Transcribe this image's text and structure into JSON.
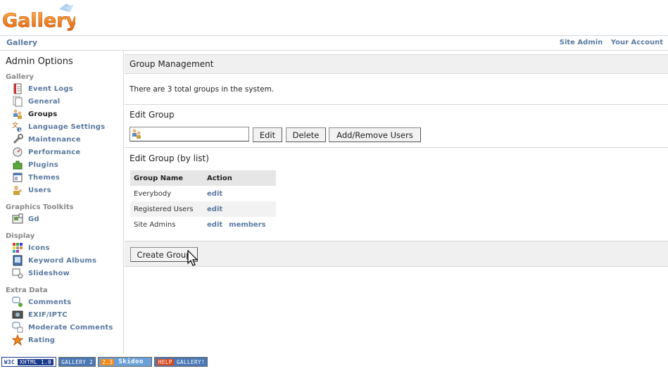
{
  "header": {
    "logo_text": "Gallery",
    "breadcrumb": "Gallery",
    "links": [
      "Site Admin",
      "Your Account"
    ]
  },
  "sidebar": {
    "title": "Admin Options",
    "groups": [
      {
        "label": "Gallery",
        "items": [
          {
            "label": "Event Logs",
            "icon": "event-logs-icon"
          },
          {
            "label": "General",
            "icon": "general-icon"
          },
          {
            "label": "Groups",
            "icon": "groups-icon",
            "active": true
          },
          {
            "label": "Language Settings",
            "icon": "language-icon"
          },
          {
            "label": "Maintenance",
            "icon": "maintenance-icon"
          },
          {
            "label": "Performance",
            "icon": "performance-icon"
          },
          {
            "label": "Plugins",
            "icon": "plugins-icon"
          },
          {
            "label": "Themes",
            "icon": "themes-icon"
          },
          {
            "label": "Users",
            "icon": "users-icon"
          }
        ]
      },
      {
        "label": "Graphics Toolkits",
        "items": [
          {
            "label": "Gd",
            "icon": "gd-icon"
          }
        ]
      },
      {
        "label": "Display",
        "items": [
          {
            "label": "Icons",
            "icon": "icons-icon"
          },
          {
            "label": "Keyword Albums",
            "icon": "keyword-albums-icon"
          },
          {
            "label": "Slideshow",
            "icon": "slideshow-icon"
          }
        ]
      },
      {
        "label": "Extra Data",
        "items": [
          {
            "label": "Comments",
            "icon": "comments-icon"
          },
          {
            "label": "EXIF/IPTC",
            "icon": "exif-icon"
          },
          {
            "label": "Moderate Comments",
            "icon": "moderate-comments-icon"
          },
          {
            "label": "Rating",
            "icon": "rating-icon"
          }
        ]
      }
    ]
  },
  "main": {
    "heading": "Group Management",
    "info": "There are 3 total groups in the system.",
    "edit_group": {
      "title": "Edit Group",
      "input_value": "",
      "buttons": [
        "Edit",
        "Delete",
        "Add/Remove Users"
      ]
    },
    "edit_by_list": {
      "title": "Edit Group (by list)",
      "columns": [
        "Group Name",
        "Action"
      ],
      "rows": [
        {
          "name": "Everybody",
          "actions": [
            "edit"
          ]
        },
        {
          "name": "Registered Users",
          "actions": [
            "edit"
          ]
        },
        {
          "name": "Site Admins",
          "actions": [
            "edit",
            "members"
          ]
        }
      ]
    },
    "create_button": "Create Group"
  },
  "badges": [
    "XHTML 1.0",
    "GALLERY 2",
    "2.3",
    "Skidoo",
    "HELP",
    "GALLERY!"
  ],
  "colors": {
    "link": "#5a7aa0",
    "panel": "#f0f0f0",
    "logo_orange": "#f08a1c"
  }
}
